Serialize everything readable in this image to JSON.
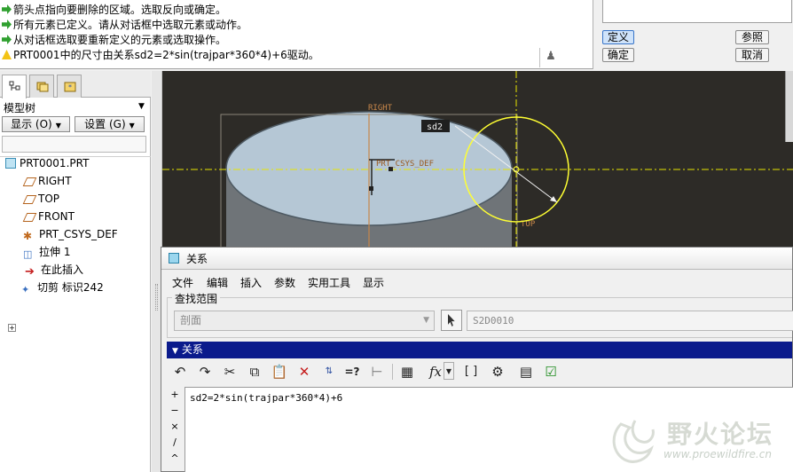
{
  "messages": [
    {
      "type": "info",
      "text": "箭头点指向要删除的区域。选取反向或确定。"
    },
    {
      "type": "info",
      "text": "所有元素已定义。请从对话框中选取元素或动作。"
    },
    {
      "type": "info",
      "text": "从对话框选取要重新定义的元素或选取操作。"
    },
    {
      "type": "warning",
      "text": "PRT0001中的尺寸由关系sd2=2*sin(trajpar*360*4)+6驱动。"
    }
  ],
  "feature_dialog": {
    "define_label": "定义",
    "reference_label": "参照",
    "ok_label": "确定",
    "cancel_label": "取消"
  },
  "model_tree": {
    "title": "模型树",
    "show_label": "显示 (O)",
    "settings_label": "设置 (G)",
    "nodes": [
      {
        "label": "PRT0001.PRT",
        "icon": "part-icon"
      },
      {
        "label": "RIGHT",
        "icon": "datum-plane-icon"
      },
      {
        "label": "TOP",
        "icon": "datum-plane-icon"
      },
      {
        "label": "FRONT",
        "icon": "datum-plane-icon"
      },
      {
        "label": "PRT_CSYS_DEF",
        "icon": "csys-icon"
      },
      {
        "label": "拉伸 1",
        "icon": "extrude-icon"
      },
      {
        "label": "在此插入",
        "icon": "insert-here-icon"
      },
      {
        "label": "切剪 标识242",
        "icon": "cut-icon"
      }
    ]
  },
  "graphics": {
    "labels": {
      "right": "RIGHT",
      "top": "TOP",
      "csys": "PRT_CSYS_DEF",
      "dim": "sd2"
    },
    "colors": {
      "background": "#2d2b27",
      "datum": "#c8874a",
      "axis": "#e6e600",
      "surface": "#b5c7d5",
      "circle": "#ffff33"
    }
  },
  "relations_dialog": {
    "title": "关系",
    "menu": [
      "文件",
      "编辑",
      "插入",
      "参数",
      "实用工具",
      "显示"
    ],
    "find_scope_label": "查找范围",
    "find_scope_value": "剖面",
    "find_field_value": "S2D0010",
    "section_label": "关系",
    "toolbar_icons": [
      "undo-icon",
      "redo-icon",
      "cut-icon",
      "copy-icon",
      "paste-icon",
      "delete-icon",
      "switch-symbols-icon",
      "evaluate-icon",
      "measure-icon",
      "sort-icon",
      "function-icon",
      "parentheses-icon",
      "verify-icon",
      "sort-relations-icon",
      "execute-icon"
    ],
    "function_label": "fx",
    "evaluate_label": "=?",
    "parentheses_label": "[ ]",
    "operators": [
      "+",
      "−",
      "×",
      "/",
      "^"
    ],
    "relation_text": "sd2=2*sin(trajpar*360*4)+6"
  },
  "watermark": {
    "text": "野火论坛",
    "url": "www.proewildfire.cn"
  }
}
